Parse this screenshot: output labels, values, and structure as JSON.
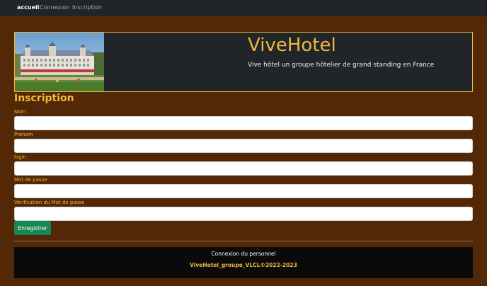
{
  "nav": {
    "items": [
      {
        "label": "accueil",
        "active": true
      },
      {
        "label": "Connexion",
        "active": false
      },
      {
        "label": "Inscription",
        "active": false
      }
    ]
  },
  "banner": {
    "title": "ViveHotel",
    "subtitle": "Vive hôtel un groupe hôtelier de grand standing en France"
  },
  "form": {
    "title": "Inscription",
    "fields": [
      {
        "label": "Nom",
        "value": ""
      },
      {
        "label": "Prénom",
        "value": ""
      },
      {
        "label": "login",
        "value": ""
      },
      {
        "label": "Mot de passe",
        "value": ""
      },
      {
        "label": "Vérification du Mot de passe",
        "value": ""
      }
    ],
    "submit_label": "Enregistrer"
  },
  "footer": {
    "staff_link": "Connexion du personnel",
    "copyright": "ViveHotel_groupe_VLCL©2022-2023"
  },
  "colors": {
    "background": "#532807",
    "accent": "#f0b93b",
    "navbar": "#212529",
    "button": "#198754",
    "footer": "#0a0a0a"
  }
}
